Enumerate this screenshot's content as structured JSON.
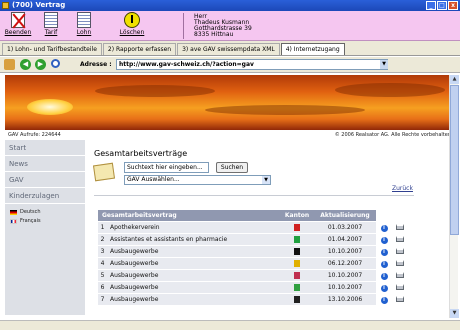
{
  "window": {
    "title": "(700) Vertrag",
    "controls": [
      "_",
      "□",
      "x"
    ]
  },
  "toolbar": {
    "buttons": [
      {
        "label": "Beenden",
        "icon": "cancel-icon"
      },
      {
        "label": "Tarif",
        "icon": "document-icon"
      },
      {
        "label": "Lohn",
        "icon": "document-icon"
      },
      {
        "label": "Löschen",
        "icon": "delete-icon"
      }
    ],
    "address_lines": [
      "Herr",
      "Thadeus Kusmann",
      "Gotthardstrasse 39",
      "8335 Hittnau"
    ]
  },
  "tabs": [
    {
      "label": "1) Lohn- und Tarifbestandteile",
      "active": false
    },
    {
      "label": "2) Rapporte erfassen",
      "active": false
    },
    {
      "label": "3) ave GAV swissempdata XML",
      "active": false
    },
    {
      "label": "4) Internetzugang",
      "active": true
    }
  ],
  "browser": {
    "address_label": "Adresse :",
    "url": "http://www.gav-schweiz.ch/?action=gav"
  },
  "banner": {
    "left_text": "GAV Aufrufe: 224644",
    "right_text": "© 2006 Realsator AG. Alle Rechte vorbehalten"
  },
  "sidebar": {
    "items": [
      "Start",
      "News",
      "GAV",
      "Kinderzulagen"
    ],
    "languages": [
      {
        "label": "Deutsch",
        "flag": "de"
      },
      {
        "label": "Français",
        "flag": "fr"
      }
    ]
  },
  "main": {
    "title": "Gesamtarbeitsverträge",
    "search_placeholder": "Suchtext hier eingeben...",
    "search_button": "Suchen",
    "select_value": "GAV Auswählen...",
    "back_link": "Zurück",
    "table": {
      "headers": [
        "Gesamtarbeitsvertrag",
        "Kanton",
        "Aktualisierung"
      ],
      "rows": [
        {
          "num": "1",
          "name": "Apothekerverein",
          "canton_color": "#d02020",
          "date": "01.03.2007"
        },
        {
          "num": "2",
          "name": "Assistantes et assistants en pharmacie",
          "canton_color": "#20a040",
          "date": "01.04.2007"
        },
        {
          "num": "3",
          "name": "Ausbaugewerbe",
          "canton_color": "#111111",
          "date": "10.10.2007"
        },
        {
          "num": "4",
          "name": "Ausbaugewerbe",
          "canton_color": "#e0b000",
          "date": "06.12.2007"
        },
        {
          "num": "5",
          "name": "Ausbaugewerbe",
          "canton_color": "#c03050",
          "date": "10.10.2007"
        },
        {
          "num": "6",
          "name": "Ausbaugewerbe",
          "canton_color": "#30a040",
          "date": "10.10.2007"
        },
        {
          "num": "7",
          "name": "Ausbaugewerbe",
          "canton_color": "#202020",
          "date": "13.10.2006"
        }
      ]
    }
  }
}
